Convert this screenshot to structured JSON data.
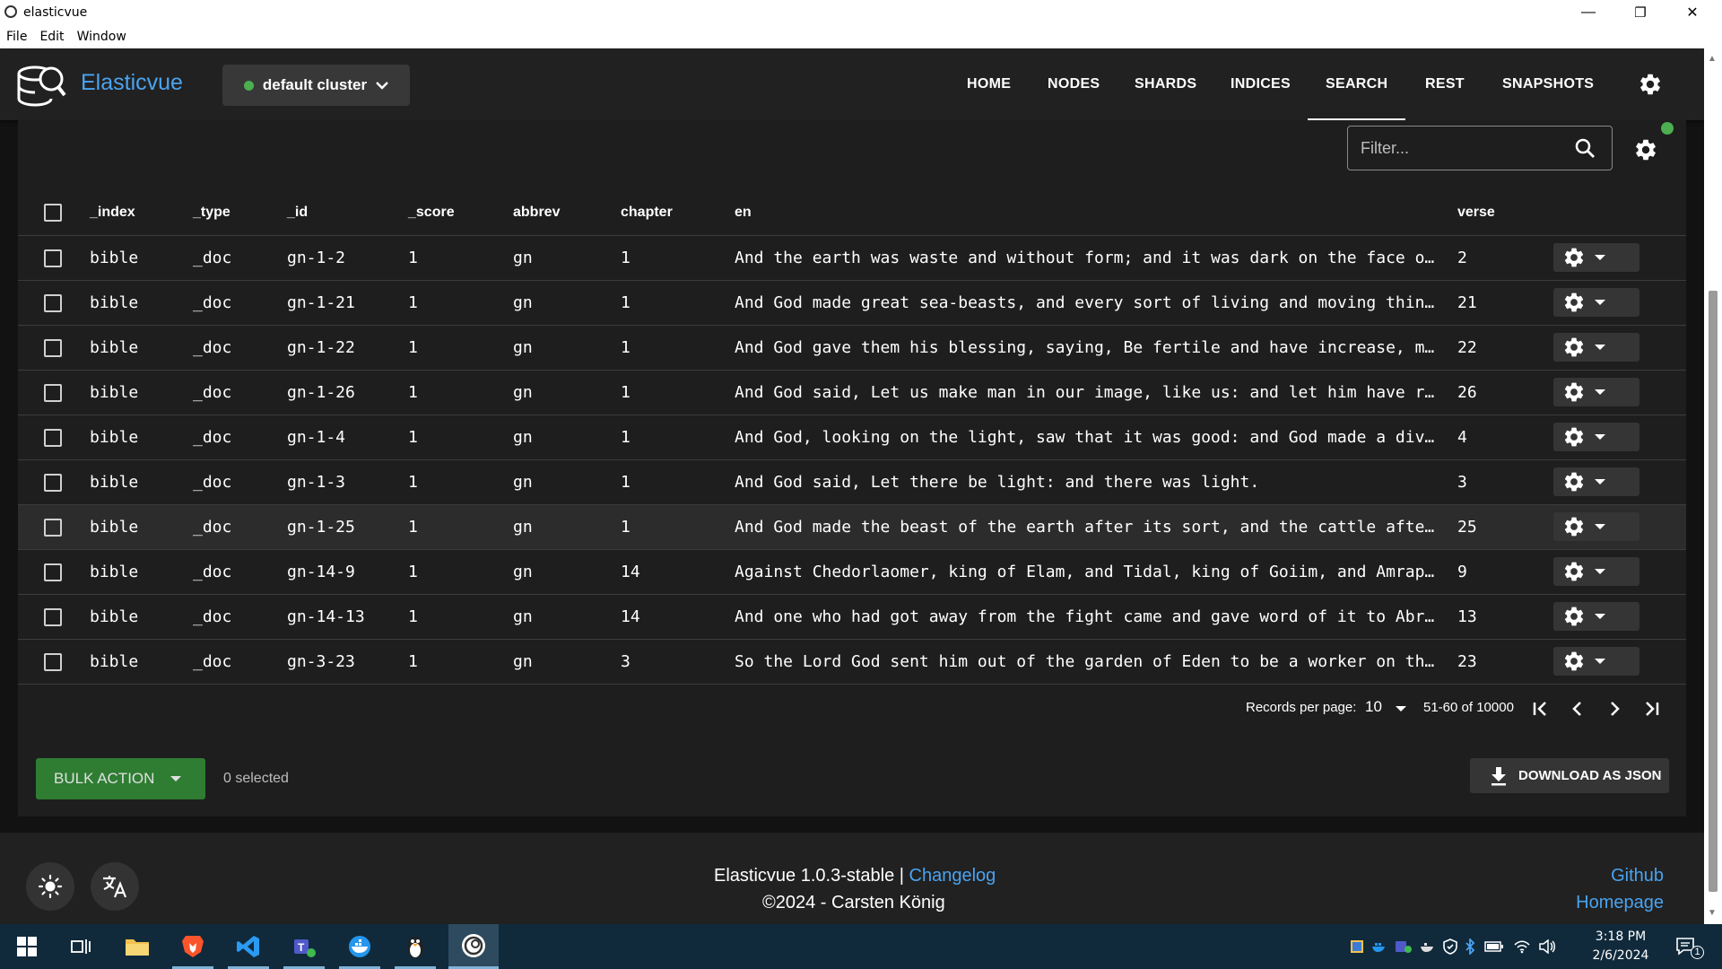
{
  "window": {
    "title": "elasticvue",
    "minimize": "—",
    "restore": "❐",
    "close": "✕"
  },
  "menu": [
    "File",
    "Edit",
    "Window"
  ],
  "app": {
    "brand": "Elasticvue",
    "cluster": "default cluster",
    "cluster_status_color": "#4caf50",
    "nav": [
      "HOME",
      "NODES",
      "SHARDS",
      "INDICES",
      "SEARCH",
      "REST",
      "SNAPSHOTS"
    ],
    "active_nav": "SEARCH"
  },
  "search": {
    "filter_placeholder": "Filter...",
    "columns": [
      "_index",
      "_type",
      "_id",
      "_score",
      "abbrev",
      "chapter",
      "en",
      "verse"
    ],
    "rows": [
      {
        "_index": "bible",
        "_type": "_doc",
        "_id": "gn-1-2",
        "_score": "1",
        "abbrev": "gn",
        "chapter": "1",
        "en": "And the earth was waste and without form; and it was dark on the face of the deep: and the Spirit of God was moving on the face of the waters.",
        "verse": "2"
      },
      {
        "_index": "bible",
        "_type": "_doc",
        "_id": "gn-1-21",
        "_score": "1",
        "abbrev": "gn",
        "chapter": "1",
        "en": "And God made great sea-beasts, and every sort of living and moving thing with which the waters were full, and every sort of winged bird: and God saw that it was good.",
        "verse": "21"
      },
      {
        "_index": "bible",
        "_type": "_doc",
        "_id": "gn-1-22",
        "_score": "1",
        "abbrev": "gn",
        "chapter": "1",
        "en": "And God gave them his blessing, saying, Be fertile and have increase, making all the waters of the seas full, and let birds be increased in the earth.",
        "verse": "22"
      },
      {
        "_index": "bible",
        "_type": "_doc",
        "_id": "gn-1-26",
        "_score": "1",
        "abbrev": "gn",
        "chapter": "1",
        "en": "And God said, Let us make man in our image, like us: and let him have rule over the fish of the sea and over the birds of the air.",
        "verse": "26"
      },
      {
        "_index": "bible",
        "_type": "_doc",
        "_id": "gn-1-4",
        "_score": "1",
        "abbrev": "gn",
        "chapter": "1",
        "en": "And God, looking on the light, saw that it was good: and God made a division between the light and the dark,",
        "verse": "4"
      },
      {
        "_index": "bible",
        "_type": "_doc",
        "_id": "gn-1-3",
        "_score": "1",
        "abbrev": "gn",
        "chapter": "1",
        "en": "And God said, Let there be light: and there was light.",
        "verse": "3"
      },
      {
        "_index": "bible",
        "_type": "_doc",
        "_id": "gn-1-25",
        "_score": "1",
        "abbrev": "gn",
        "chapter": "1",
        "en": "And God made the beast of the earth after its sort, and the cattle after their sort, and everything moving on the face of the earth after its sort.",
        "verse": "25"
      },
      {
        "_index": "bible",
        "_type": "_doc",
        "_id": "gn-14-9",
        "_score": "1",
        "abbrev": "gn",
        "chapter": "14",
        "en": "Against Chedorlaomer, king of Elam, and Tidal, king of Goiim, and Amraphel, king of Shinar, and Arioch, king of Ellasar; four kings against the five.",
        "verse": "9"
      },
      {
        "_index": "bible",
        "_type": "_doc",
        "_id": "gn-14-13",
        "_score": "1",
        "abbrev": "gn",
        "chapter": "14",
        "en": "And one who had got away from the fight came and gave word of it to Abram, the Hebrew.",
        "verse": "13"
      },
      {
        "_index": "bible",
        "_type": "_doc",
        "_id": "gn-3-23",
        "_score": "1",
        "abbrev": "gn",
        "chapter": "3",
        "en": "So the Lord God sent him out of the garden of Eden to be a worker on the earth from which he was taken.",
        "verse": "23"
      }
    ],
    "highlighted_row": "gn-1-25",
    "records_per_page_label": "Records per page:",
    "records_per_page": "10",
    "range": "51-60 of 10000",
    "bulk_action": "BULK ACTION",
    "selected": "0 selected",
    "download": "DOWNLOAD AS JSON"
  },
  "footer": {
    "version": "Elasticvue 1.0.3-stable | ",
    "changelog": "Changelog",
    "copyright": "©2024 - Carsten König",
    "github": "Github",
    "homepage": "Homepage"
  },
  "taskbar": {
    "apps": [
      "start-icon",
      "task-view-icon",
      "file-explorer-icon",
      "brave-icon",
      "vscode-icon",
      "teams-icon",
      "docker-icon",
      "linux-penguin-icon",
      "elasticvue-icon"
    ],
    "time": "3:18 PM",
    "date": "2/6/2024",
    "notifications": "1"
  }
}
